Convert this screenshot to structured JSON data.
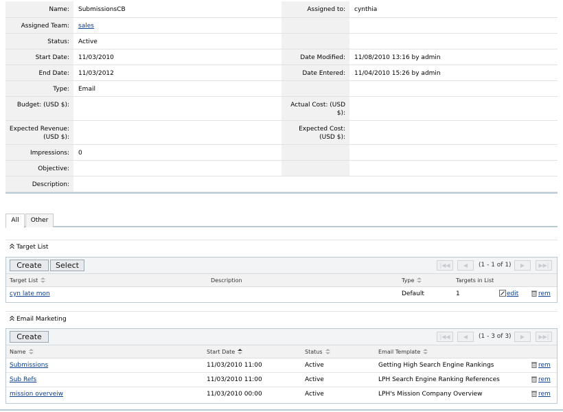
{
  "detail": {
    "rows": [
      {
        "l1": "Name:",
        "v1": "SubmissionsCB",
        "l2": "Assigned to:",
        "v2": "cynthia"
      },
      {
        "l1": "Assigned Team:",
        "v1": "sales ",
        "l2": "",
        "v2": ""
      },
      {
        "l1": "Status:",
        "v1": "Active",
        "l2": "",
        "v2": ""
      },
      {
        "l1": "Start Date:",
        "v1": "11/03/2010",
        "l2": "Date Modified:",
        "v2": "11/08/2010 13:16 by admin"
      },
      {
        "l1": "End Date:",
        "v1": "11/03/2012",
        "l2": "Date Entered:",
        "v2": "11/04/2010 15:26 by admin"
      },
      {
        "l1": "Type:",
        "v1": "Email",
        "l2": "",
        "v2": ""
      },
      {
        "l1": "Budget: (USD $):",
        "v1": "",
        "l2": "Actual Cost: (USD $):",
        "v2": ""
      },
      {
        "l1": "Expected Revenue: (USD $):",
        "v1": "",
        "l2": "Expected Cost: (USD $):",
        "v2": ""
      },
      {
        "l1": "Impressions:",
        "v1": "0",
        "l2": "",
        "v2": ""
      },
      {
        "l1": "Objective:",
        "v1": "",
        "l2": "",
        "v2": ""
      },
      {
        "l1": "Description:",
        "v1": "",
        "l2": "",
        "v2": ""
      }
    ]
  },
  "tabs": {
    "all": "All",
    "other": "Other"
  },
  "target_list": {
    "title": "Target List",
    "create_label": "Create",
    "select_label": "Select",
    "pagination": "(1 - 1 of 1)",
    "columns": {
      "name": "Target List",
      "description": "Description",
      "type": "Type",
      "targets": "Targets in List"
    },
    "rows": [
      {
        "name": "cyn late mon",
        "description": "",
        "type": "Default",
        "targets": "1",
        "edit": "edit",
        "remove": "rem"
      }
    ]
  },
  "email_marketing": {
    "title": "Email Marketing",
    "create_label": "Create",
    "pagination": "(1 - 3 of 3)",
    "columns": {
      "name": "Name",
      "start": "Start Date",
      "status": "Status",
      "template": "Email Template"
    },
    "rows": [
      {
        "name": "Submissions",
        "start": "11/03/2010 11:00",
        "status": "Active",
        "template": "Getting High Search Engine Rankings",
        "remove": "rem"
      },
      {
        "name": "Sub Refs",
        "start": "11/03/2010 11:00",
        "status": "Active",
        "template": "LPH Search Engine Ranking References",
        "remove": "rem"
      },
      {
        "name": "mission overveiw",
        "start": "11/03/2010 00:00",
        "status": "Active",
        "template": "LPH's Mission Company Overview",
        "remove": "rem"
      }
    ]
  },
  "icons": {
    "collapse": "double-chevron-up-icon",
    "sort": "sort-arrows-icon",
    "edit": "pencil-icon",
    "remove": "trash-icon",
    "first": "first-page-icon",
    "prev": "previous-page-icon",
    "next": "next-page-icon",
    "last": "last-page-icon"
  },
  "colors": {
    "link": "#0b3d91",
    "label_bg": "#f1f1f1",
    "border_accent": "#b8c9d6"
  }
}
